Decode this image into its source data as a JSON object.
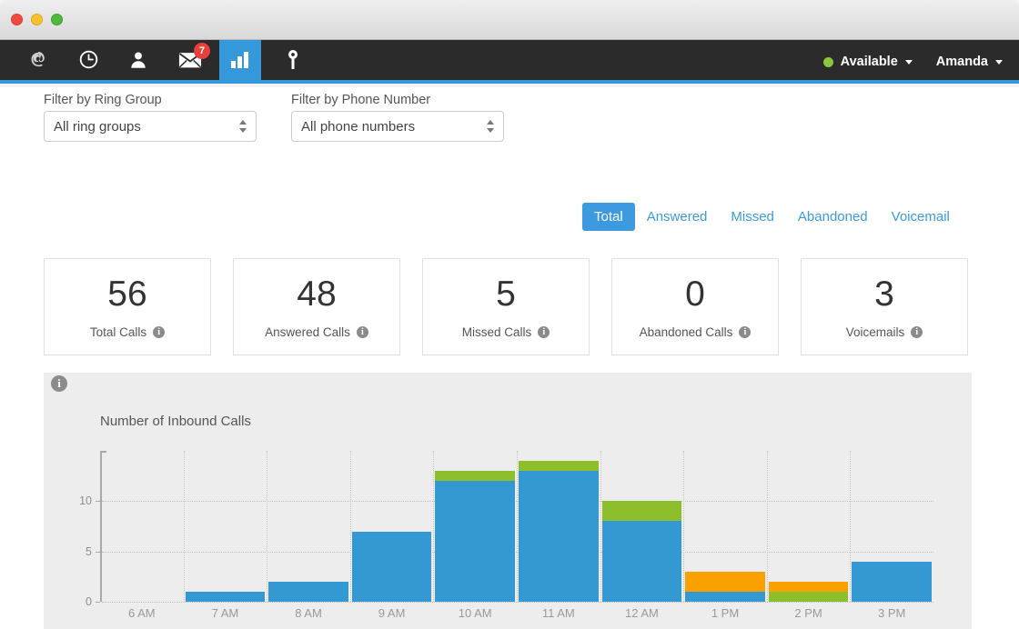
{
  "window": {
    "controls": [
      "close",
      "minimize",
      "maximize"
    ]
  },
  "navbar": {
    "tabs": [
      {
        "id": "brand",
        "icon": "e-logo-icon",
        "active": false,
        "badge": null
      },
      {
        "id": "history",
        "icon": "clock-icon",
        "active": false,
        "badge": null
      },
      {
        "id": "contacts",
        "icon": "person-icon",
        "active": false,
        "badge": null
      },
      {
        "id": "messages",
        "icon": "envelope-icon",
        "active": false,
        "badge": "7"
      },
      {
        "id": "analytics",
        "icon": "bar-chart-icon",
        "active": true,
        "badge": null
      },
      {
        "id": "keys",
        "icon": "key-icon",
        "active": false,
        "badge": null
      }
    ],
    "status": {
      "label": "Available",
      "dot_color": "#8cc63e"
    },
    "user": {
      "name": "Amanda"
    },
    "accent_color": "#3498db",
    "background_color": "#2b2b2b"
  },
  "filters": {
    "ring_group": {
      "label": "Filter by Ring Group",
      "value": "All ring groups"
    },
    "phone_number": {
      "label": "Filter by Phone Number",
      "value": "All phone numbers"
    }
  },
  "metric_tabs": [
    {
      "label": "Total",
      "active": true
    },
    {
      "label": "Answered",
      "active": false
    },
    {
      "label": "Missed",
      "active": false
    },
    {
      "label": "Abandoned",
      "active": false
    },
    {
      "label": "Voicemail",
      "active": false
    }
  ],
  "stat_cards": [
    {
      "value": "56",
      "label": "Total Calls",
      "info": "i"
    },
    {
      "value": "48",
      "label": "Answered Calls",
      "info": "i"
    },
    {
      "value": "5",
      "label": "Missed Calls",
      "info": "i"
    },
    {
      "value": "0",
      "label": "Abandoned Calls",
      "info": "i"
    },
    {
      "value": "3",
      "label": "Voicemails",
      "info": "i"
    }
  ],
  "chart_info_icon": "i",
  "chart_data": {
    "type": "bar",
    "stacked": true,
    "title": "Number of Inbound Calls",
    "xlabel": "",
    "ylabel": "",
    "ylim": [
      0,
      15
    ],
    "yticks": [
      0,
      5,
      10
    ],
    "ytick_labels": [
      "0",
      "5",
      "10"
    ],
    "grid": true,
    "legend": "none",
    "categories": [
      "6 AM",
      "7 AM",
      "8 AM",
      "9 AM",
      "10 AM",
      "11 AM",
      "12 AM",
      "1 PM",
      "2 PM",
      "3 PM"
    ],
    "series": [
      {
        "name": "Answered",
        "color": "#3498d2",
        "values": [
          0,
          1,
          2,
          7,
          12,
          13,
          8,
          1,
          0,
          4
        ]
      },
      {
        "name": "Missed",
        "color": "#8cbf2b",
        "values": [
          0,
          0,
          0,
          0,
          1,
          1,
          2,
          0,
          1,
          0
        ]
      },
      {
        "name": "Voicemail",
        "color": "#faa100",
        "values": [
          0,
          0,
          0,
          0,
          0,
          0,
          0,
          2,
          1,
          0
        ]
      }
    ],
    "totals": [
      0,
      1,
      2,
      7,
      13,
      14,
      10,
      3,
      2,
      4
    ],
    "plot_background": "#ededed"
  }
}
